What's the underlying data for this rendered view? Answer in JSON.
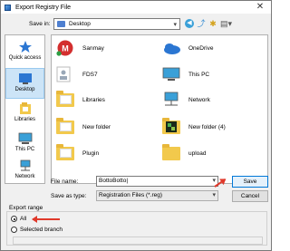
{
  "window": {
    "title": "Export Registry File"
  },
  "savein": {
    "label": "Save in:",
    "value": "Desktop"
  },
  "places": [
    {
      "label": "Quick access",
      "icon": "quick-access-star-icon"
    },
    {
      "label": "Desktop",
      "icon": "desktop-icon",
      "selected": true
    },
    {
      "label": "Libraries",
      "icon": "libraries-icon"
    },
    {
      "label": "This PC",
      "icon": "this-pc-icon"
    },
    {
      "label": "Network",
      "icon": "network-icon"
    }
  ],
  "files": [
    {
      "name": "Sanmay",
      "icon": "user-avatar-icon"
    },
    {
      "name": "OneDrive",
      "icon": "onedrive-cloud-icon"
    },
    {
      "name": "FDS7",
      "icon": "user-folder-icon"
    },
    {
      "name": "This PC",
      "icon": "this-pc-icon"
    },
    {
      "name": "Libraries",
      "icon": "libraries-folder-icon"
    },
    {
      "name": "Network",
      "icon": "network-icon"
    },
    {
      "name": "New folder",
      "icon": "folder-icon"
    },
    {
      "name": "New folder (4)",
      "icon": "folder-icon"
    },
    {
      "name": "Plugin",
      "icon": "folder-icon"
    },
    {
      "name": "upload",
      "icon": "folder-icon"
    }
  ],
  "form": {
    "filename_label": "File name:",
    "filename_value": "BottoBotto|",
    "saveastype_label": "Save as type:",
    "saveastype_value": "Registration Files (*.reg)",
    "save_label": "Save",
    "cancel_label": "Cancel"
  },
  "export_range": {
    "label": "Export range",
    "all_label": "All",
    "selected_branch_label": "Selected branch",
    "selected": "All"
  },
  "colors": {
    "annotation_arrow": "#e0392b",
    "selection": "#cce4f7"
  }
}
